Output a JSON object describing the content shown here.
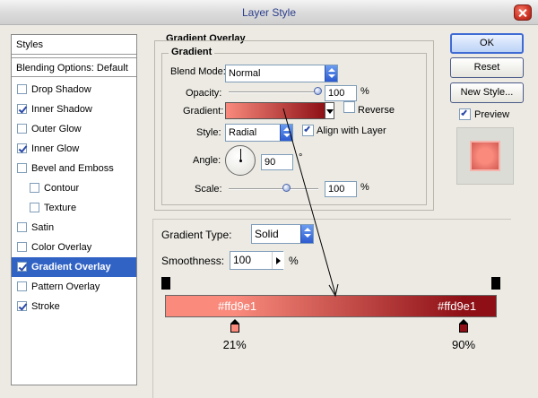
{
  "window": {
    "title": "Layer Style"
  },
  "styles": {
    "header": "Styles",
    "blending_options": "Blending Options: Default",
    "items": [
      {
        "label": "Drop Shadow",
        "checked": false,
        "sub": false,
        "selected": false
      },
      {
        "label": "Inner Shadow",
        "checked": true,
        "sub": false,
        "selected": false
      },
      {
        "label": "Outer Glow",
        "checked": false,
        "sub": false,
        "selected": false
      },
      {
        "label": "Inner Glow",
        "checked": true,
        "sub": false,
        "selected": false
      },
      {
        "label": "Bevel and Emboss",
        "checked": false,
        "sub": false,
        "selected": false
      },
      {
        "label": "Contour",
        "checked": false,
        "sub": true,
        "selected": false
      },
      {
        "label": "Texture",
        "checked": false,
        "sub": true,
        "selected": false
      },
      {
        "label": "Satin",
        "checked": false,
        "sub": false,
        "selected": false
      },
      {
        "label": "Color Overlay",
        "checked": false,
        "sub": false,
        "selected": false
      },
      {
        "label": "Gradient Overlay",
        "checked": true,
        "sub": false,
        "selected": true
      },
      {
        "label": "Pattern Overlay",
        "checked": false,
        "sub": false,
        "selected": false
      },
      {
        "label": "Stroke",
        "checked": true,
        "sub": false,
        "selected": false
      }
    ]
  },
  "gradient_overlay": {
    "section_title": "Gradient Overlay",
    "group_title": "Gradient",
    "blend_mode_label": "Blend Mode:",
    "blend_mode_value": "Normal",
    "opacity_label": "Opacity:",
    "opacity_value": "100",
    "opacity_level": 1.0,
    "percent": "%",
    "gradient_label": "Gradient:",
    "reverse_label": "Reverse",
    "reverse_checked": false,
    "style_label": "Style:",
    "style_value": "Radial",
    "align_label": "Align with Layer",
    "align_checked": true,
    "angle_label": "Angle:",
    "angle_value": "90",
    "degree": "°",
    "scale_label": "Scale:",
    "scale_value": "100",
    "scale_level": 0.5
  },
  "gradient_editor": {
    "type_label": "Gradient Type:",
    "type_value": "Solid",
    "smoothness_label": "Smoothness:",
    "smoothness_value": "100",
    "percent": "%",
    "left_color_label": "#ffd9e1",
    "right_color_label": "#ffd9e1",
    "left_stop_location": "21%",
    "right_stop_location": "90%",
    "left_stop_fraction": 0.21,
    "right_stop_fraction": 0.9
  },
  "buttons": {
    "ok": "OK",
    "reset": "Reset",
    "new_style": "New Style...",
    "preview_label": "Preview",
    "preview_checked": true
  },
  "colors": {
    "gradient_start": "#f98a7c",
    "gradient_end": "#8e1016",
    "selection": "#3163c5",
    "title_text": "#2c3e8c"
  }
}
